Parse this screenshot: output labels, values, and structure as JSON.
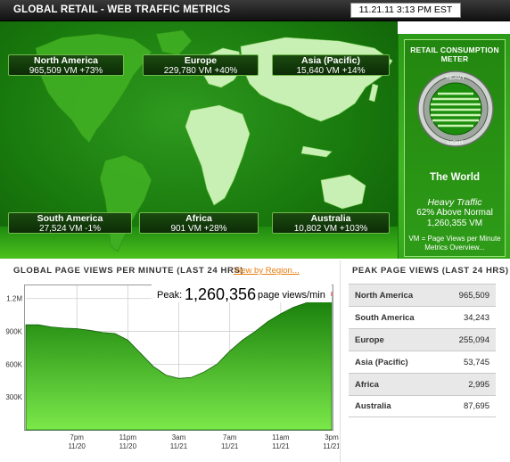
{
  "header": {
    "title": "GLOBAL RETAIL - WEB TRAFFIC METRICS",
    "timestamp": "11.21.11  3:13 PM EST"
  },
  "regions": [
    {
      "name": "North America",
      "stats": "965,509 VM +73%"
    },
    {
      "name": "Europe",
      "stats": "229,780 VM +40%"
    },
    {
      "name": "Asia (Pacific)",
      "stats": "15,640 VM +14%"
    },
    {
      "name": "South America",
      "stats": "27,524 VM -1%"
    },
    {
      "name": "Africa",
      "stats": "901 VM +28%"
    },
    {
      "name": "Australia",
      "stats": "10,802 VM +103%"
    }
  ],
  "meter": {
    "title": "RETAIL CONSUMPTION METER",
    "heavy_label": "HEAVY",
    "light_label": "LIGHT",
    "scope": "The World",
    "traffic_level": "Heavy Traffic",
    "above_normal": "62% Above Normal",
    "value": "1,260,355 VM",
    "note_line1": "VM = Page Views per Minute",
    "note_line2": "Metrics Overview..."
  },
  "chart_section": {
    "title": "GLOBAL PAGE VIEWS PER MINUTE (LAST 24 HRS)",
    "region_link": "View by Region..."
  },
  "chart_data": {
    "type": "area",
    "title": "",
    "xlabel": "",
    "ylabel": "",
    "ylim": [
      0,
      1320000
    ],
    "yticks": [
      300000,
      600000,
      900000,
      1200000
    ],
    "ytick_labels": [
      "300K",
      "600K",
      "900K",
      "1.2M"
    ],
    "xticks": [
      {
        "line1": "7pm",
        "line2": "11/20",
        "h": 4
      },
      {
        "line1": "11pm",
        "line2": "11/20",
        "h": 8
      },
      {
        "line1": "3am",
        "line2": "11/21",
        "h": 12
      },
      {
        "line1": "7am",
        "line2": "11/21",
        "h": 16
      },
      {
        "line1": "11am",
        "line2": "11/21",
        "h": 20
      },
      {
        "line1": "3pm",
        "line2": "11/21",
        "h": 24
      }
    ],
    "x_hours": [
      0,
      1,
      2,
      3,
      4,
      5,
      6,
      7,
      8,
      9,
      10,
      11,
      12,
      13,
      14,
      15,
      16,
      17,
      18,
      19,
      20,
      21,
      22,
      23,
      24
    ],
    "values": [
      960000,
      960000,
      940000,
      930000,
      925000,
      910000,
      890000,
      880000,
      820000,
      700000,
      580000,
      500000,
      470000,
      480000,
      530000,
      600000,
      720000,
      820000,
      900000,
      990000,
      1060000,
      1120000,
      1160000,
      1200000,
      1260356
    ],
    "peak_prefix": "Peak:",
    "peak_value": "1,260,356",
    "peak_suffix": "page views/min"
  },
  "peak_section": {
    "title": "PEAK PAGE VIEWS (LAST 24 HRS)",
    "rows": [
      {
        "region": "North America",
        "value": "965,509"
      },
      {
        "region": "South America",
        "value": "34,243"
      },
      {
        "region": "Europe",
        "value": "255,094"
      },
      {
        "region": "Asia (Pacific)",
        "value": "53,745"
      },
      {
        "region": "Africa",
        "value": "2,995"
      },
      {
        "region": "Australia",
        "value": "87,695"
      }
    ]
  }
}
